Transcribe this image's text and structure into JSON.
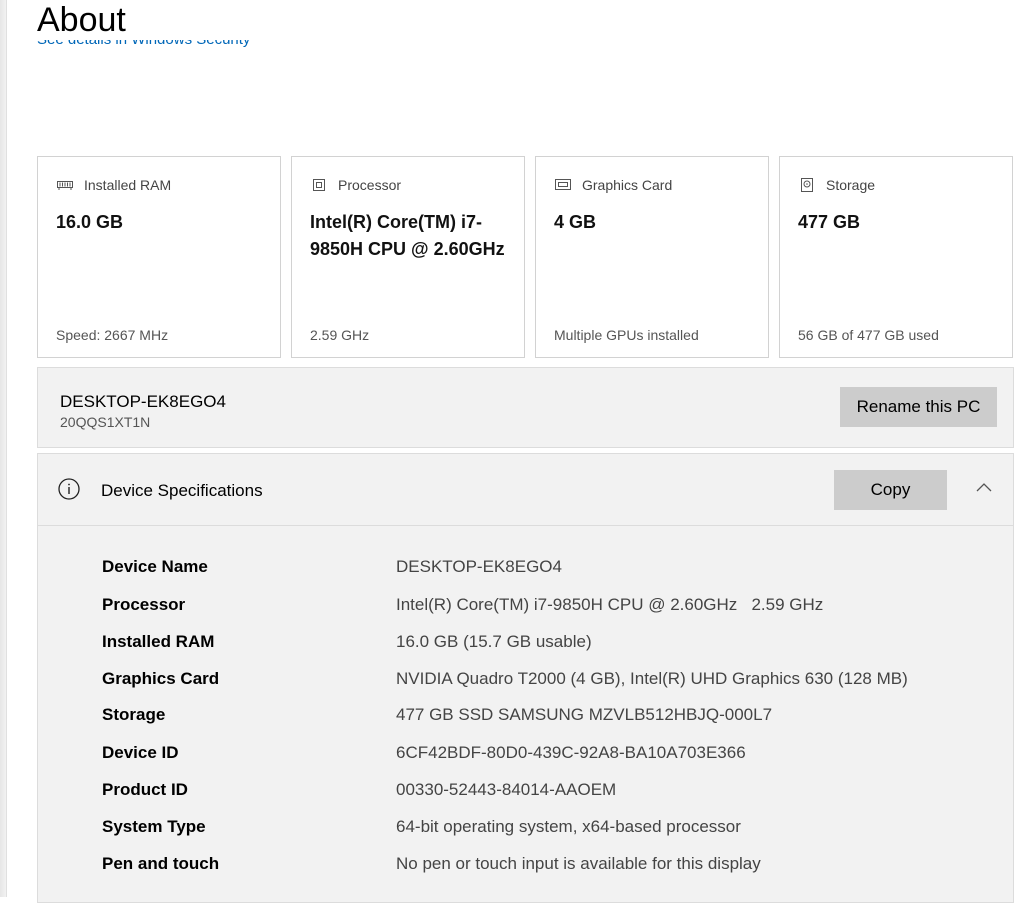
{
  "page": {
    "title": "About",
    "security_link": "See details in Windows Security"
  },
  "cards": [
    {
      "label": "Installed RAM",
      "icon": "ram-icon",
      "value": "16.0 GB",
      "footer": "Speed: 2667 MHz"
    },
    {
      "label": "Processor",
      "icon": "processor-icon",
      "value": "Intel(R) Core(TM) i7-9850H CPU @ 2.60GHz",
      "footer": "2.59 GHz"
    },
    {
      "label": "Graphics Card",
      "icon": "graphics-card-icon",
      "value": "4 GB",
      "footer": "Multiple GPUs installed"
    },
    {
      "label": "Storage",
      "icon": "storage-icon",
      "value": "477 GB",
      "footer": "56 GB of 477 GB used"
    }
  ],
  "pc": {
    "name": "DESKTOP-EK8EGO4",
    "model": "20QQS1XT1N",
    "rename_label": "Rename this PC"
  },
  "specs": {
    "title": "Device Specifications",
    "copy_label": "Copy",
    "rows": [
      {
        "label": "Device Name",
        "value": "DESKTOP-EK8EGO4"
      },
      {
        "label": "Processor",
        "value": "Intel(R) Core(TM) i7-9850H CPU @ 2.60GHz   2.59 GHz"
      },
      {
        "label": "Installed RAM",
        "value": "16.0 GB (15.7 GB usable)"
      },
      {
        "label": "Graphics Card",
        "value": "NVIDIA Quadro T2000 (4 GB), Intel(R) UHD Graphics 630 (128 MB)"
      },
      {
        "label": "Storage",
        "value": "477 GB SSD SAMSUNG MZVLB512HBJQ-000L7"
      },
      {
        "label": "Device ID",
        "value": "6CF42BDF-80D0-439C-92A8-BA10A703E366"
      },
      {
        "label": "Product ID",
        "value": "00330-52443-84014-AAOEM"
      },
      {
        "label": "System Type",
        "value": "64-bit operating system, x64-based processor"
      },
      {
        "label": "Pen and touch",
        "value": "No pen or touch input is available for this display"
      }
    ]
  },
  "colors": {
    "link": "#0067b8",
    "button": "#cccccc",
    "panel": "#f2f2f2"
  }
}
